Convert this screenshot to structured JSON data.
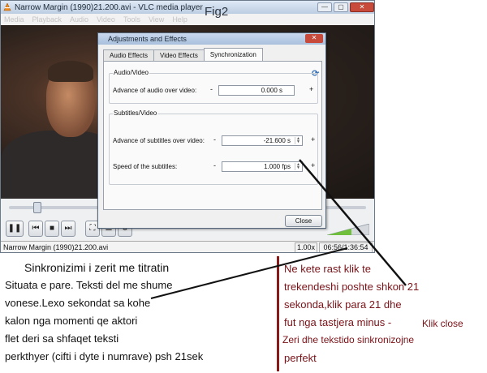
{
  "window": {
    "title": "Narrow Margin (1990)21.200.avi - VLC media player",
    "buttons": {
      "minimize": "—",
      "maximize": "▢",
      "close": "✕"
    }
  },
  "menubar": {
    "items": [
      "Media",
      "Playback",
      "Audio",
      "Video",
      "Tools",
      "View",
      "Help"
    ]
  },
  "figure_label": "Fig2",
  "dialog": {
    "title": "Adjustments and Effects",
    "tabs": [
      "Audio Effects",
      "Video Effects",
      "Synchronization"
    ],
    "active_tab": "Synchronization",
    "audio_video": {
      "heading": "Audio/Video",
      "row_label": "Advance of audio over video:",
      "value": "0.000 s"
    },
    "subtitles_video": {
      "heading": "Subtitles/Video",
      "advance_label": "Advance of subtitles over video:",
      "advance_value": "-21.600 s",
      "speed_label": "Speed of the subtitles:",
      "speed_value": "1.000 fps"
    },
    "minus": "-",
    "plus": "+",
    "close_label": "Close"
  },
  "controls": {
    "pause": "❚❚",
    "prev": "⏮",
    "stop": "■",
    "next": "⏭",
    "fullscreen": "⛶",
    "playlist": "☰",
    "ext": "⚙"
  },
  "statusbar": {
    "filename": "Narrow Margin (1990)21.200.avi",
    "speed": "1.00x",
    "time": "06:56/1:36:54"
  },
  "notes_left": [
    "Sinkronizimi i zerit me titratin",
    "Situata e pare. Teksti del me shume",
    "vonese.Lexo sekondat sa kohe",
    "kalon nga momenti qe aktori",
    "flet deri sa shfaqet teksti",
    "perkthyer (cifti i dyte i numrave) psh 21sek"
  ],
  "notes_right": [
    "Ne kete rast klik te",
    "trekendeshi poshte shkon 21",
    "sekonda,klik para 21 dhe",
    "fut nga tastjera minus -",
    "Klik close",
    "Zeri dhe tekstido sinkronizojne",
    "perfekt"
  ]
}
